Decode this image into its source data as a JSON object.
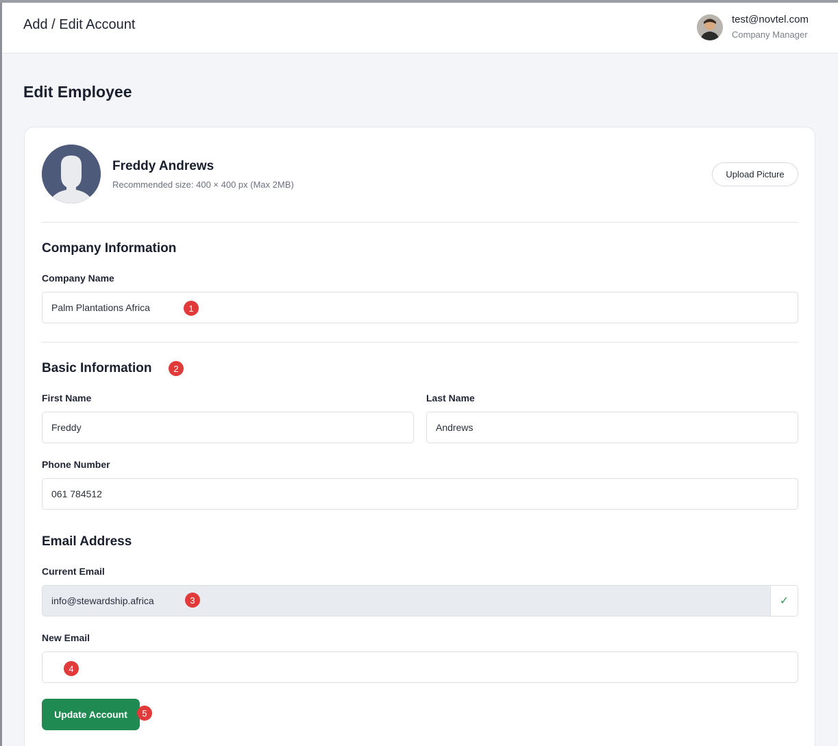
{
  "header": {
    "title": "Add / Edit Account",
    "user_email": "test@novtel.com",
    "user_role": "Company Manager"
  },
  "page": {
    "title": "Edit Employee"
  },
  "profile": {
    "name": "Freddy Andrews",
    "hint": "Recommended size: 400 × 400 px (Max 2MB)",
    "upload_label": "Upload Picture"
  },
  "company": {
    "section_title": "Company Information",
    "name_label": "Company Name",
    "name_value": "Palm Plantations Africa"
  },
  "basic": {
    "section_title": "Basic Information",
    "first_name_label": "First Name",
    "first_name_value": "Freddy",
    "last_name_label": "Last Name",
    "last_name_value": "Andrews",
    "phone_label": "Phone Number",
    "phone_value": "061 784512"
  },
  "email": {
    "section_title": "Email Address",
    "current_label": "Current Email",
    "current_value": "info@stewardship.africa",
    "verified_icon": "✓",
    "new_label": "New Email",
    "new_value": ""
  },
  "actions": {
    "submit_label": "Update Account"
  },
  "markers": [
    "1",
    "2",
    "3",
    "4",
    "5"
  ],
  "colors": {
    "primary": "#1f8a52",
    "marker": "#e03a3a",
    "avatar_bg": "#4d5a7a"
  }
}
